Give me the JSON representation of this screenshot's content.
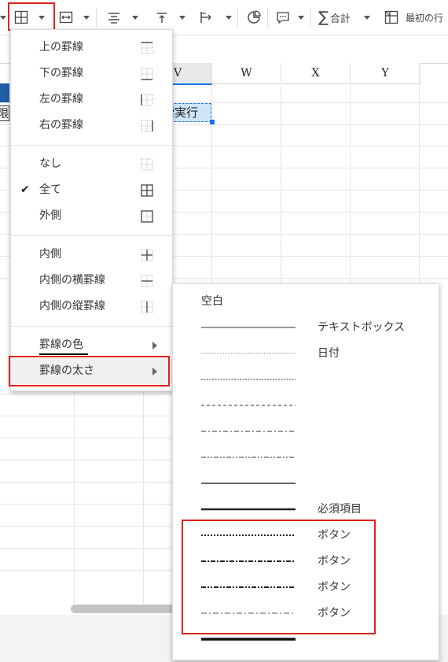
{
  "toolbar": {
    "sum_label": "合計",
    "first_row_label": "最初の行"
  },
  "columns": [
    "V",
    "W",
    "X",
    "Y"
  ],
  "cells": {
    "left_fragment": "限",
    "selected_cell_text": "索実行"
  },
  "border_menu": {
    "group1": [
      "上の罫線",
      "下の罫線",
      "左の罫線",
      "右の罫線"
    ],
    "group2": [
      "なし",
      "全て",
      "外側"
    ],
    "checked_item": "全て",
    "group3": [
      "内側",
      "内側の横罫線",
      "内側の縦罫線"
    ],
    "group4": [
      "罫線の色",
      "罫線の太さ"
    ]
  },
  "thickness_submenu": {
    "blank_label": "空白",
    "rows": [
      {
        "style": "solid-thin",
        "label": "テキストボックス"
      },
      {
        "style": "dotted-fine",
        "label": "日付"
      },
      {
        "style": "dotted-small",
        "label": ""
      },
      {
        "style": "dashed",
        "label": ""
      },
      {
        "style": "dash-dot",
        "label": ""
      },
      {
        "style": "dash-dot-dot",
        "label": ""
      },
      {
        "style": "solid-medium",
        "label": ""
      },
      {
        "style": "solid-thick",
        "label": "必須項目"
      },
      {
        "style": "dotted-bold",
        "label": "ボタン"
      },
      {
        "style": "dash-dot-bold",
        "label": "ボタン"
      },
      {
        "style": "dash-dot-dot-bold",
        "label": "ボタン"
      },
      {
        "style": "dash-dot-light",
        "label": "ボタン"
      },
      {
        "style": "solid-heavy",
        "label": ""
      }
    ]
  },
  "colors": {
    "highlight_red": "#e2231a",
    "selection_blue": "#1a73e8",
    "cell_fill": "#cfe6f8",
    "header_blue": "#1f5fa8"
  }
}
